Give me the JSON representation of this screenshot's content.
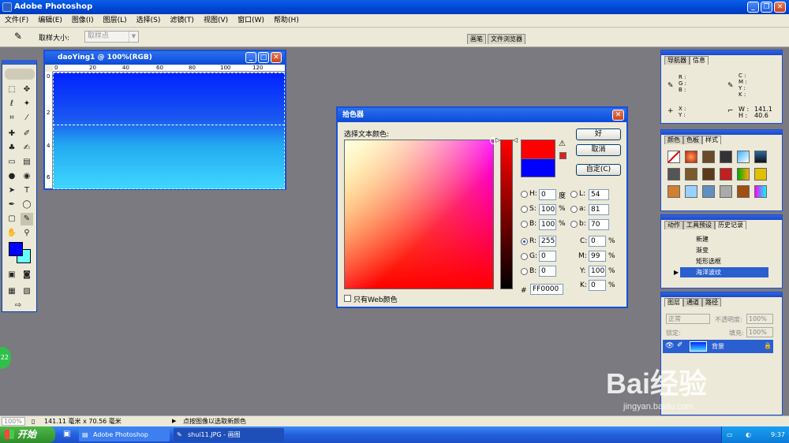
{
  "window": {
    "title": "Adobe Photoshop"
  },
  "menu": [
    "文件(F)",
    "编辑(E)",
    "图像(I)",
    "图层(L)",
    "选择(S)",
    "滤镜(T)",
    "视图(V)",
    "窗口(W)",
    "帮助(H)"
  ],
  "options": {
    "sample_size_label": "取样大小:",
    "sample_size_value": "取样点"
  },
  "workspace_tabs": [
    "画笔",
    "文件浏览器"
  ],
  "document": {
    "title": "daoYing1 @ 100%(RGB)",
    "ruler_top": [
      "0",
      "20",
      "40",
      "60",
      "80",
      "100",
      "120"
    ],
    "ruler_left": [
      "0",
      "2",
      "4",
      "6"
    ]
  },
  "color_picker": {
    "title": "拾色器",
    "prompt": "选择文本颜色:",
    "ok_label": "好",
    "cancel_label": "取消",
    "custom_label": "自定(C)",
    "web_only_label": "只有Web颜色",
    "hsb": {
      "h": "0",
      "s": "100",
      "b": "100",
      "h_unit": "度",
      "s_unit": "%",
      "b_unit": "%"
    },
    "lab": {
      "l": "54",
      "a": "81",
      "b": "70"
    },
    "rgb": {
      "r": "255",
      "g": "0",
      "b": "0"
    },
    "cmyk": {
      "c": "0",
      "m": "99",
      "y": "100",
      "k": "0",
      "unit": "%"
    },
    "hex": "FF0000",
    "new_color": "#ff0000",
    "current_color": "#0000ff",
    "labels": {
      "h": "H:",
      "s": "S:",
      "b": "B:",
      "r": "R:",
      "g": "G:",
      "bb": "B:",
      "l": "L:",
      "a": "a:",
      "lb": "b:",
      "c": "C:",
      "m": "M:",
      "y": "Y:",
      "k": "K:",
      "hash": "#"
    }
  },
  "panels": {
    "info": {
      "tabs": [
        "导航器",
        "信息"
      ],
      "rgb_labels": "R :\nG :\nB :",
      "cmyk_labels": "C :\nM :\nY :\nK :",
      "xy_labels": "X :\nY :",
      "w_label": "W :",
      "h_label": "H :",
      "w_value": "141.1",
      "h_value": "40.6"
    },
    "swatches": {
      "tabs": [
        "颜色",
        "色板",
        "样式"
      ]
    },
    "history": {
      "tabs": [
        "动作",
        "工具预设",
        "历史记录"
      ],
      "items": [
        "新建",
        "渐变",
        "矩形选框",
        "海洋波纹"
      ],
      "selected_index": 3
    },
    "layers": {
      "tabs": [
        "图层",
        "通道",
        "路径"
      ],
      "blend_mode": "正常",
      "opacity_label": "不透明度:",
      "opacity_value": "100%",
      "lock_label": "锁定:",
      "fill_label": "填充:",
      "fill_value": "100%",
      "layer_name": "背景"
    }
  },
  "status": {
    "zoom": "100%",
    "doc_size": "141.11 毫米 x 70.56 毫米",
    "hint": "点按图像以选取新颜色"
  },
  "taskbar": {
    "start_label": "开始",
    "items": [
      "Adobe Photoshop",
      "shui11.JPG - 画图"
    ],
    "clock": "9:37"
  },
  "badge": "22",
  "watermark": {
    "text": "Bai经验",
    "url": "jingyan.baidu.com"
  }
}
